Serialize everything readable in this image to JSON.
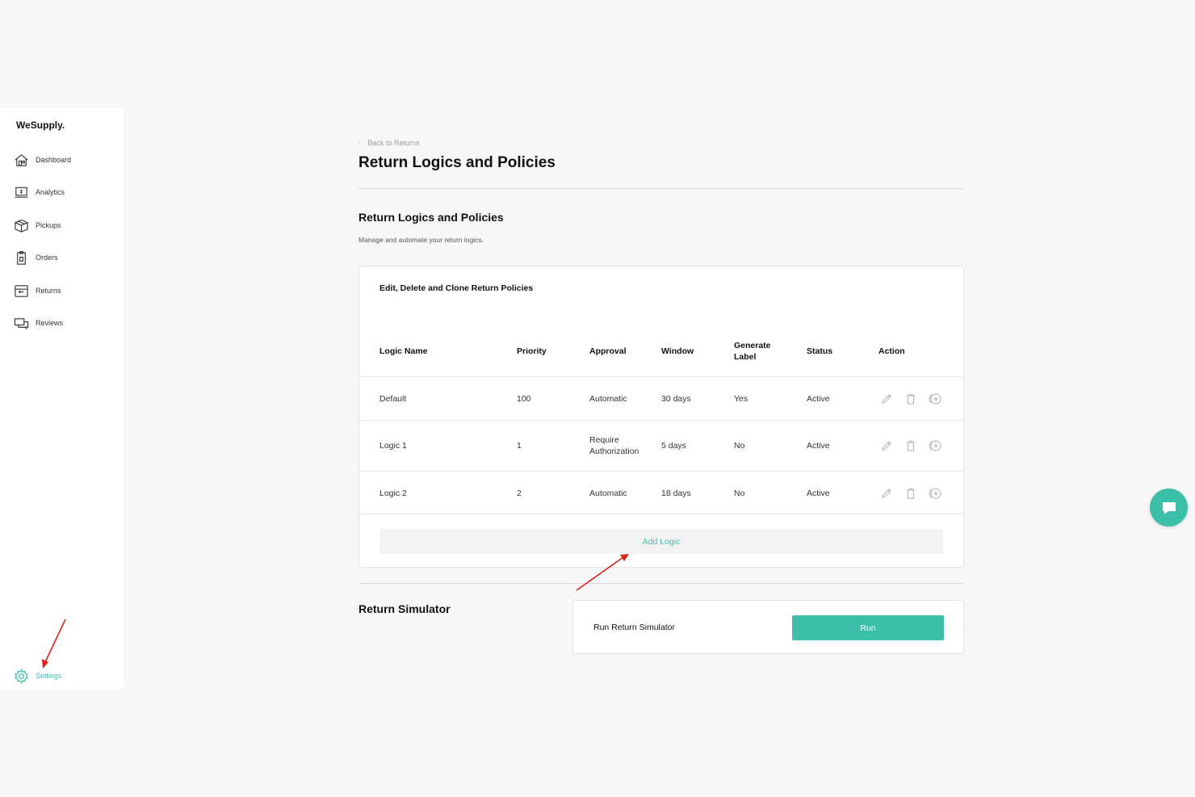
{
  "brand": {
    "name": "WeSupply.",
    "accent": "#3cbfa8"
  },
  "sidebar": {
    "items": [
      {
        "label": "Dashboard",
        "icon": "home-icon"
      },
      {
        "label": "Analytics",
        "icon": "analytics-icon"
      },
      {
        "label": "Pickups",
        "icon": "box-icon"
      },
      {
        "label": "Orders",
        "icon": "clipboard-icon"
      },
      {
        "label": "Returns",
        "icon": "returns-icon"
      },
      {
        "label": "Reviews",
        "icon": "reviews-icon"
      }
    ],
    "settings": {
      "label": "Settings",
      "icon": "gear-icon"
    }
  },
  "header": {
    "back_label": "Back to Returns",
    "title": "Return Logics and Policies"
  },
  "section": {
    "title": "Return Logics and Policies",
    "subtitle": "Manage and automate your return logics."
  },
  "policies_card": {
    "title": "Edit, Delete and Clone Return Policies",
    "columns": [
      "Logic Name",
      "Priority",
      "Approval",
      "Window",
      "Generate Label",
      "Status",
      "Action"
    ],
    "rows": [
      {
        "name": "Default",
        "priority": "100",
        "approval": "Automatic",
        "window": "30 days",
        "generate_label": "Yes",
        "status": "Active"
      },
      {
        "name": "Logic 1",
        "priority": "1",
        "approval": "Require Authorization",
        "window": "5 days",
        "generate_label": "No",
        "status": "Active"
      },
      {
        "name": "Logic 2",
        "priority": "2",
        "approval": "Automatic",
        "window": "18 days",
        "generate_label": "No",
        "status": "Active"
      }
    ],
    "action_icons": [
      "edit-icon",
      "delete-icon",
      "clone-icon"
    ],
    "add_label": "Add Logic"
  },
  "simulator": {
    "title": "Return Simulator",
    "label": "Run Return Simulator",
    "button_label": "Run"
  },
  "chat": {
    "icon": "chat-icon"
  },
  "annotations": {
    "arrow_color": "#e0201b"
  }
}
